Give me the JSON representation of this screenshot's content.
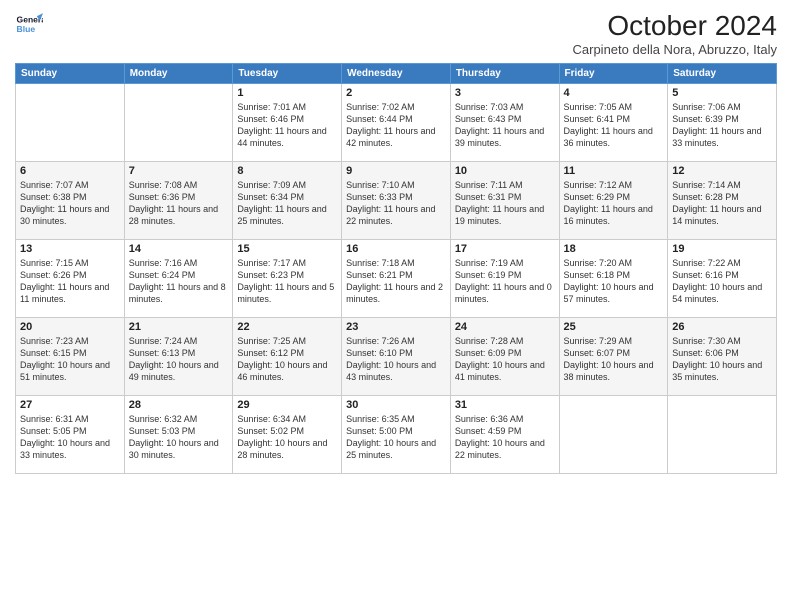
{
  "header": {
    "logo": {
      "line1": "General",
      "line2": "Blue"
    },
    "title": "October 2024",
    "subtitle": "Carpineto della Nora, Abruzzo, Italy"
  },
  "days_of_week": [
    "Sunday",
    "Monday",
    "Tuesday",
    "Wednesday",
    "Thursday",
    "Friday",
    "Saturday"
  ],
  "weeks": [
    [
      {
        "day": "",
        "info": ""
      },
      {
        "day": "",
        "info": ""
      },
      {
        "day": "1",
        "info": "Sunrise: 7:01 AM\nSunset: 6:46 PM\nDaylight: 11 hours and 44 minutes."
      },
      {
        "day": "2",
        "info": "Sunrise: 7:02 AM\nSunset: 6:44 PM\nDaylight: 11 hours and 42 minutes."
      },
      {
        "day": "3",
        "info": "Sunrise: 7:03 AM\nSunset: 6:43 PM\nDaylight: 11 hours and 39 minutes."
      },
      {
        "day": "4",
        "info": "Sunrise: 7:05 AM\nSunset: 6:41 PM\nDaylight: 11 hours and 36 minutes."
      },
      {
        "day": "5",
        "info": "Sunrise: 7:06 AM\nSunset: 6:39 PM\nDaylight: 11 hours and 33 minutes."
      }
    ],
    [
      {
        "day": "6",
        "info": "Sunrise: 7:07 AM\nSunset: 6:38 PM\nDaylight: 11 hours and 30 minutes."
      },
      {
        "day": "7",
        "info": "Sunrise: 7:08 AM\nSunset: 6:36 PM\nDaylight: 11 hours and 28 minutes."
      },
      {
        "day": "8",
        "info": "Sunrise: 7:09 AM\nSunset: 6:34 PM\nDaylight: 11 hours and 25 minutes."
      },
      {
        "day": "9",
        "info": "Sunrise: 7:10 AM\nSunset: 6:33 PM\nDaylight: 11 hours and 22 minutes."
      },
      {
        "day": "10",
        "info": "Sunrise: 7:11 AM\nSunset: 6:31 PM\nDaylight: 11 hours and 19 minutes."
      },
      {
        "day": "11",
        "info": "Sunrise: 7:12 AM\nSunset: 6:29 PM\nDaylight: 11 hours and 16 minutes."
      },
      {
        "day": "12",
        "info": "Sunrise: 7:14 AM\nSunset: 6:28 PM\nDaylight: 11 hours and 14 minutes."
      }
    ],
    [
      {
        "day": "13",
        "info": "Sunrise: 7:15 AM\nSunset: 6:26 PM\nDaylight: 11 hours and 11 minutes."
      },
      {
        "day": "14",
        "info": "Sunrise: 7:16 AM\nSunset: 6:24 PM\nDaylight: 11 hours and 8 minutes."
      },
      {
        "day": "15",
        "info": "Sunrise: 7:17 AM\nSunset: 6:23 PM\nDaylight: 11 hours and 5 minutes."
      },
      {
        "day": "16",
        "info": "Sunrise: 7:18 AM\nSunset: 6:21 PM\nDaylight: 11 hours and 2 minutes."
      },
      {
        "day": "17",
        "info": "Sunrise: 7:19 AM\nSunset: 6:19 PM\nDaylight: 11 hours and 0 minutes."
      },
      {
        "day": "18",
        "info": "Sunrise: 7:20 AM\nSunset: 6:18 PM\nDaylight: 10 hours and 57 minutes."
      },
      {
        "day": "19",
        "info": "Sunrise: 7:22 AM\nSunset: 6:16 PM\nDaylight: 10 hours and 54 minutes."
      }
    ],
    [
      {
        "day": "20",
        "info": "Sunrise: 7:23 AM\nSunset: 6:15 PM\nDaylight: 10 hours and 51 minutes."
      },
      {
        "day": "21",
        "info": "Sunrise: 7:24 AM\nSunset: 6:13 PM\nDaylight: 10 hours and 49 minutes."
      },
      {
        "day": "22",
        "info": "Sunrise: 7:25 AM\nSunset: 6:12 PM\nDaylight: 10 hours and 46 minutes."
      },
      {
        "day": "23",
        "info": "Sunrise: 7:26 AM\nSunset: 6:10 PM\nDaylight: 10 hours and 43 minutes."
      },
      {
        "day": "24",
        "info": "Sunrise: 7:28 AM\nSunset: 6:09 PM\nDaylight: 10 hours and 41 minutes."
      },
      {
        "day": "25",
        "info": "Sunrise: 7:29 AM\nSunset: 6:07 PM\nDaylight: 10 hours and 38 minutes."
      },
      {
        "day": "26",
        "info": "Sunrise: 7:30 AM\nSunset: 6:06 PM\nDaylight: 10 hours and 35 minutes."
      }
    ],
    [
      {
        "day": "27",
        "info": "Sunrise: 6:31 AM\nSunset: 5:05 PM\nDaylight: 10 hours and 33 minutes."
      },
      {
        "day": "28",
        "info": "Sunrise: 6:32 AM\nSunset: 5:03 PM\nDaylight: 10 hours and 30 minutes."
      },
      {
        "day": "29",
        "info": "Sunrise: 6:34 AM\nSunset: 5:02 PM\nDaylight: 10 hours and 28 minutes."
      },
      {
        "day": "30",
        "info": "Sunrise: 6:35 AM\nSunset: 5:00 PM\nDaylight: 10 hours and 25 minutes."
      },
      {
        "day": "31",
        "info": "Sunrise: 6:36 AM\nSunset: 4:59 PM\nDaylight: 10 hours and 22 minutes."
      },
      {
        "day": "",
        "info": ""
      },
      {
        "day": "",
        "info": ""
      }
    ]
  ]
}
